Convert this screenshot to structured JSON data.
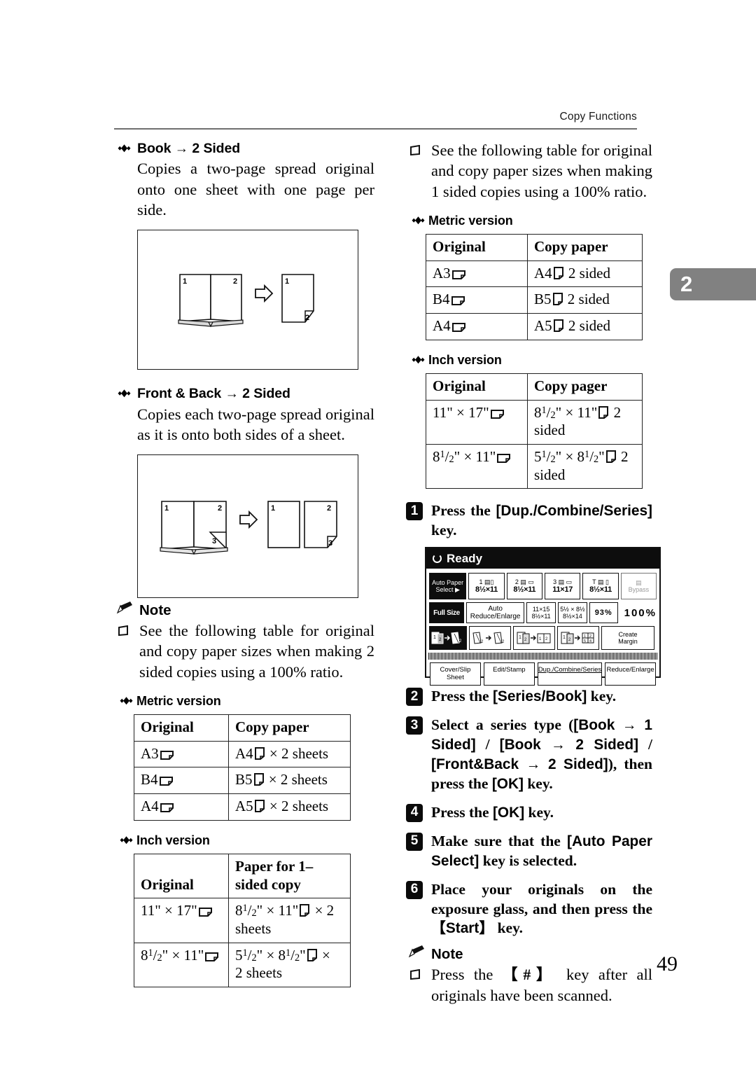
{
  "header": {
    "running_head": "Copy Functions",
    "chapter_tab": "2",
    "page_number": "49"
  },
  "left_column": {
    "section1": {
      "heading": "Book → 2 Sided",
      "body": "Copies a two-page spread original onto one sheet with one page per side.",
      "figure": {
        "name": "book-to-2-sided-diagram",
        "original_labels": [
          "1",
          "2"
        ],
        "copy_labels": [
          "1",
          "2"
        ]
      }
    },
    "section2": {
      "heading": "Front & Back → 2 Sided",
      "body": "Copies each two-page spread original as it is onto both sides of a sheet.",
      "figure": {
        "name": "front-back-to-2-sided-diagram",
        "original_labels": [
          "1",
          "2",
          "3"
        ],
        "copy_labels": [
          "1",
          "2",
          "3"
        ]
      }
    },
    "note": {
      "label": "Note",
      "items": [
        "See the following table for original and copy paper sizes when making 2 sided copies using a 100% ratio."
      ]
    },
    "metric": {
      "heading": "Metric version",
      "columns": [
        "Original",
        "Copy paper"
      ],
      "rows": [
        {
          "original": "A3",
          "original_orient": "landscape",
          "copy": "A4",
          "copy_orient": "portrait",
          "copy_suffix": "× 2 sheets"
        },
        {
          "original": "B4",
          "original_orient": "landscape",
          "copy": "B5",
          "copy_orient": "portrait",
          "copy_suffix": "× 2 sheets"
        },
        {
          "original": "A4",
          "original_orient": "landscape",
          "copy": "A5",
          "copy_orient": "portrait",
          "copy_suffix": "× 2 sheets"
        }
      ]
    },
    "inch": {
      "heading": "Inch version",
      "columns": [
        "Original",
        "Paper for 1–sided copy"
      ],
      "rows": [
        {
          "original": "11\" × 17\"",
          "original_orient": "landscape",
          "copy": "8 1/2\" × 11\"",
          "copy_orient": "portrait",
          "copy_suffix": "× 2 sheets"
        },
        {
          "original": "8 1/2\" × 11\"",
          "original_orient": "landscape",
          "copy": "5 1/2\" × 8 1/2\"",
          "copy_orient": "portrait",
          "copy_suffix": "× 2 sheets"
        }
      ]
    }
  },
  "right_column": {
    "note_item": "See the following table for original and copy paper sizes when making 1 sided copies using a 100% ratio.",
    "metric": {
      "heading": "Metric version",
      "columns": [
        "Original",
        "Copy paper"
      ],
      "rows": [
        {
          "original": "A3",
          "copy": "A4",
          "copy_suffix": "2 sided"
        },
        {
          "original": "B4",
          "copy": "B5",
          "copy_suffix": "2 sided"
        },
        {
          "original": "A4",
          "copy": "A5",
          "copy_suffix": "2 sided"
        }
      ]
    },
    "inch": {
      "heading": "Inch version",
      "columns": [
        "Original",
        "Copy pager"
      ],
      "rows": [
        {
          "original": "11\" × 17\"",
          "copy": "8 1/2\" × 11\"",
          "copy_suffix": "2 sided"
        },
        {
          "original": "8 1/2\" × 11\"",
          "copy": "5 1/2\" × 8 1/2\"",
          "copy_suffix": "2 sided"
        }
      ]
    },
    "steps": [
      {
        "num": "1",
        "text": "Press the [Dup./Combine/Series] key."
      },
      {
        "num": "2",
        "text": "Press the [Series/Book] key."
      },
      {
        "num": "3",
        "text": "Select a series type ([Book → 1 Sided] / [Book → 2 Sided] / [Front&Back → 2 Sided]), then press the [OK] key."
      },
      {
        "num": "4",
        "text": "Press the [OK] key."
      },
      {
        "num": "5",
        "text": "Make sure that the [Auto Paper Select] key is selected."
      },
      {
        "num": "6",
        "text": "Place your originals on the exposure glass, and then press the 【Start】 key."
      }
    ],
    "note": {
      "label": "Note",
      "items": [
        "Press the 【#】 key after all originals have been scanned."
      ]
    }
  },
  "lcd_panel": {
    "status": "Ready",
    "paper_trays": [
      {
        "label_top": "Auto Paper",
        "label_bottom": "Select ▶",
        "selected": true
      },
      {
        "label_top": "1",
        "label_bottom": "8½×11",
        "selected": false
      },
      {
        "label_top": "2",
        "label_bottom": "8½×11",
        "selected": false
      },
      {
        "label_top": "3",
        "label_bottom": "11×17",
        "selected": false
      },
      {
        "label_top": "T",
        "label_bottom": "8½×11",
        "selected": false
      },
      {
        "label_top": "",
        "label_bottom": "Bypass",
        "selected": false,
        "dim": true
      }
    ],
    "zoom_row": [
      {
        "label": "Full Size",
        "selected": true
      },
      {
        "label": "Auto Reduce/Enlarge",
        "selected": false
      },
      {
        "label_top": "11×15",
        "label_bottom": "8½×11",
        "selected": false
      },
      {
        "label_top": "5½ × 8½",
        "label_bottom": "8½×14",
        "selected": false
      },
      {
        "label": "93%",
        "selected": false
      }
    ],
    "ratio_display": "100%",
    "duplex_row": [
      {
        "name": "book-to-2-sided-key",
        "selected": true
      },
      {
        "name": "2-sided-to-2-sided-key",
        "selected": false
      },
      {
        "name": "2-sided-to-1-sided-key",
        "selected": false
      },
      {
        "name": "combine-key",
        "selected": false
      },
      {
        "label": "Create Margin",
        "selected": false
      }
    ],
    "bottom_tabs": [
      "Cover/Slip Sheet",
      "Edit/Stamp",
      "Dup./Combine/Series",
      "Reduce/Enlarge"
    ]
  }
}
